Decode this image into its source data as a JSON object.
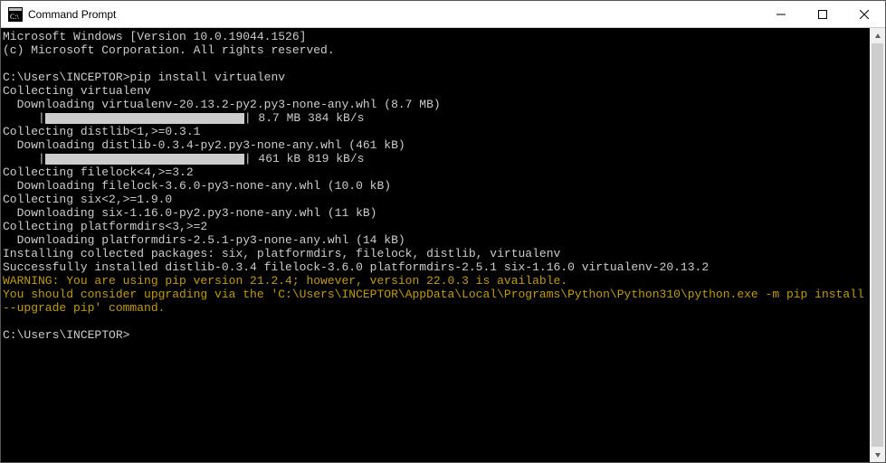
{
  "window": {
    "title": "Command Prompt"
  },
  "terminal": {
    "lines": [
      {
        "t": "plain",
        "text": "Microsoft Windows [Version 10.0.19044.1526]"
      },
      {
        "t": "plain",
        "text": "(c) Microsoft Corporation. All rights reserved."
      },
      {
        "t": "plain",
        "text": ""
      },
      {
        "t": "plain",
        "text": "C:\\Users\\INCEPTOR>pip install virtualenv"
      },
      {
        "t": "plain",
        "text": "Collecting virtualenv"
      },
      {
        "t": "plain",
        "text": "  Downloading virtualenv-20.13.2-py2.py3-none-any.whl (8.7 MB)"
      },
      {
        "t": "progress",
        "indent": "     |",
        "rest": "| 8.7 MB 384 kB/s"
      },
      {
        "t": "plain",
        "text": "Collecting distlib<1,>=0.3.1"
      },
      {
        "t": "plain",
        "text": "  Downloading distlib-0.3.4-py2.py3-none-any.whl (461 kB)"
      },
      {
        "t": "progress",
        "indent": "     |",
        "rest": "| 461 kB 819 kB/s"
      },
      {
        "t": "plain",
        "text": "Collecting filelock<4,>=3.2"
      },
      {
        "t": "plain",
        "text": "  Downloading filelock-3.6.0-py3-none-any.whl (10.0 kB)"
      },
      {
        "t": "plain",
        "text": "Collecting six<2,>=1.9.0"
      },
      {
        "t": "plain",
        "text": "  Downloading six-1.16.0-py2.py3-none-any.whl (11 kB)"
      },
      {
        "t": "plain",
        "text": "Collecting platformdirs<3,>=2"
      },
      {
        "t": "plain",
        "text": "  Downloading platformdirs-2.5.1-py3-none-any.whl (14 kB)"
      },
      {
        "t": "plain",
        "text": "Installing collected packages: six, platformdirs, filelock, distlib, virtualenv"
      },
      {
        "t": "plain",
        "text": "Successfully installed distlib-0.3.4 filelock-3.6.0 platformdirs-2.5.1 six-1.16.0 virtualenv-20.13.2"
      },
      {
        "t": "warn",
        "text": "WARNING: You are using pip version 21.2.4; however, version 22.0.3 is available."
      },
      {
        "t": "warn",
        "text": "You should consider upgrading via the 'C:\\Users\\INCEPTOR\\AppData\\Local\\Programs\\Python\\Python310\\python.exe -m pip install --upgrade pip' command."
      },
      {
        "t": "plain",
        "text": ""
      },
      {
        "t": "plain",
        "text": "C:\\Users\\INCEPTOR>"
      }
    ]
  }
}
